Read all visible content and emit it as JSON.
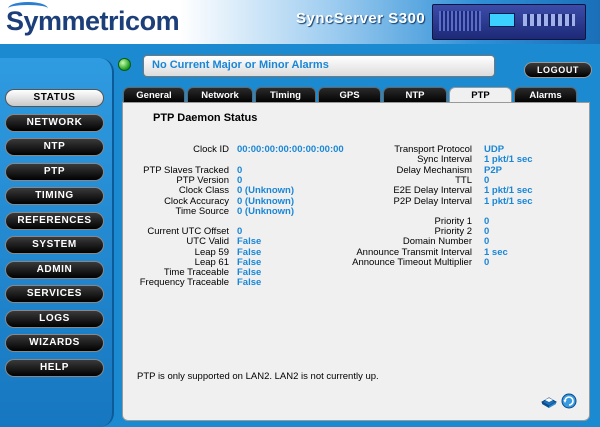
{
  "header": {
    "brand": "Symmetricom",
    "product": "SyncServer S300"
  },
  "status": {
    "alarm_text": "No Current Major or Minor Alarms",
    "logout_label": "LOGOUT"
  },
  "sidebar": {
    "items": [
      {
        "label": "STATUS"
      },
      {
        "label": "NETWORK"
      },
      {
        "label": "NTP"
      },
      {
        "label": "PTP"
      },
      {
        "label": "TIMING"
      },
      {
        "label": "REFERENCES"
      },
      {
        "label": "SYSTEM"
      },
      {
        "label": "ADMIN"
      },
      {
        "label": "SERVICES"
      },
      {
        "label": "LOGS"
      },
      {
        "label": "WIZARDS"
      },
      {
        "label": "HELP"
      }
    ]
  },
  "tabs": [
    {
      "label": "General"
    },
    {
      "label": "Network"
    },
    {
      "label": "Timing"
    },
    {
      "label": "GPS"
    },
    {
      "label": "NTP"
    },
    {
      "label": "PTP"
    },
    {
      "label": "Alarms"
    }
  ],
  "panel": {
    "title": "PTP Daemon Status",
    "left": [
      {
        "label": "Clock ID",
        "value": "00:00:00:00:00:00:00:00"
      },
      {
        "label": "PTP Slaves Tracked",
        "value": "0"
      },
      {
        "label": "PTP Version",
        "value": "0"
      },
      {
        "label": "Clock Class",
        "value": "0 (Unknown)"
      },
      {
        "label": "Clock Accuracy",
        "value": "0 (Unknown)"
      },
      {
        "label": "Time Source",
        "value": "0 (Unknown)"
      },
      {
        "label": "Current UTC Offset",
        "value": "0"
      },
      {
        "label": "UTC Valid",
        "value": "False"
      },
      {
        "label": "Leap 59",
        "value": "False"
      },
      {
        "label": "Leap 61",
        "value": "False"
      },
      {
        "label": "Time Traceable",
        "value": "False"
      },
      {
        "label": "Frequency Traceable",
        "value": "False"
      }
    ],
    "right": [
      {
        "label": "Transport Protocol",
        "value": "UDP"
      },
      {
        "label": "Sync Interval",
        "value": "1 pkt/1 sec"
      },
      {
        "label": "Delay Mechanism",
        "value": "P2P"
      },
      {
        "label": "TTL",
        "value": "0"
      },
      {
        "label": "E2E Delay Interval",
        "value": "1 pkt/1 sec"
      },
      {
        "label": "P2P Delay Interval",
        "value": "1 pkt/1 sec"
      },
      {
        "label": "Priority 1",
        "value": "0"
      },
      {
        "label": "Priority 2",
        "value": "0"
      },
      {
        "label": "Domain Number",
        "value": "0"
      },
      {
        "label": "Announce Transmit Interval",
        "value": "1 sec"
      },
      {
        "label": "Announce Timeout Multiplier",
        "value": "0"
      }
    ],
    "note": "PTP is only supported on LAN2. LAN2 is not currently up."
  },
  "colors": {
    "accent": "#1a86d6",
    "background": "#1c8ad0",
    "status_led": "#1a9a1a"
  },
  "icons": {
    "status_led": "green-status-led-icon",
    "help": "help-book-icon",
    "refresh": "refresh-icon"
  }
}
